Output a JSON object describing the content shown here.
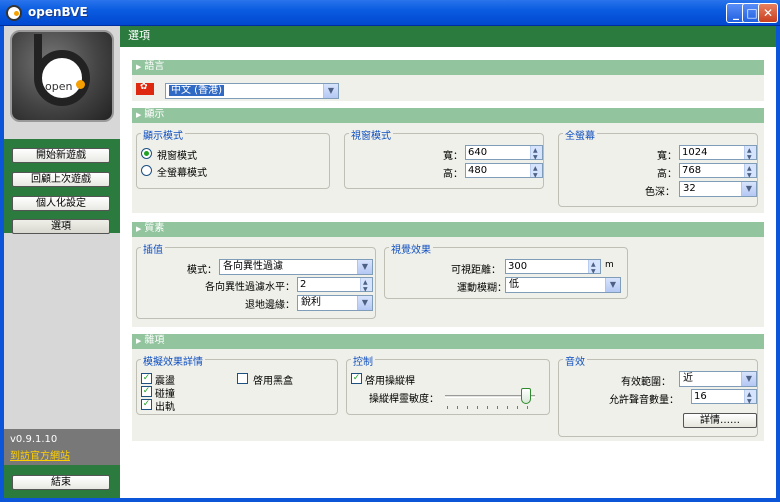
{
  "window": {
    "title": "openBVE"
  },
  "sidebar": {
    "logo_text": "open",
    "buttons": [
      {
        "label": "開始新遊戲"
      },
      {
        "label": "回顧上次遊戲"
      },
      {
        "label": "個人化設定"
      },
      {
        "label": "選項"
      }
    ],
    "version": "v0.9.1.10",
    "website_link": "到訪官方網站",
    "exit_label": "結束"
  },
  "page": {
    "title": "選項"
  },
  "language": {
    "header": "語言",
    "selected": "中文 (香港)"
  },
  "display": {
    "header": "顯示",
    "mode_group": {
      "label": "顯示模式",
      "windowed": "視窗模式",
      "fullscreen": "全螢幕模式"
    },
    "window_group": {
      "label": "視窗模式",
      "width_label": "寬：",
      "width": "640",
      "height_label": "高：",
      "height": "480"
    },
    "fullscreen_group": {
      "label": "全螢幕",
      "width_label": "寬：",
      "width": "1024",
      "height_label": "高：",
      "height": "768",
      "depth_label": "色深：",
      "depth": "32"
    }
  },
  "quality": {
    "header": "質素",
    "interp_group": {
      "label": "插值",
      "mode_label": "模式：",
      "mode": "各向異性過濾",
      "aniso_label": "各向異性過濾水平：",
      "aniso": "2",
      "wrap_label": "退地邊緣：",
      "wrap": "銳利"
    },
    "visual_group": {
      "label": "視覺效果",
      "distance_label": "可視距離：",
      "distance": "300",
      "distance_unit": "m",
      "blur_label": "運動模糊：",
      "blur": "低"
    }
  },
  "misc": {
    "header": "雜項",
    "sim_group": {
      "label": "模擬效果詳情",
      "derail": "震盪",
      "collision": "碰撞",
      "toppling": "出軌",
      "blackbox": "啓用黑盒"
    },
    "control_group": {
      "label": "控制",
      "joystick": "啓用操縱桿",
      "sensitivity_label": "操縱桿靈敏度：",
      "sensitivity_fraction": 0.95
    },
    "sound_group": {
      "label": "音效",
      "range_label": "有效範圍：",
      "range": "近",
      "count_label": "允許聲音數量：",
      "count": "16",
      "details_label": "詳情……"
    }
  },
  "colors": {
    "accent_green": "#2b7a3e",
    "section_green": "#92c49e",
    "title_blue": "#0a5ce0",
    "group_label": "#1050c0"
  }
}
